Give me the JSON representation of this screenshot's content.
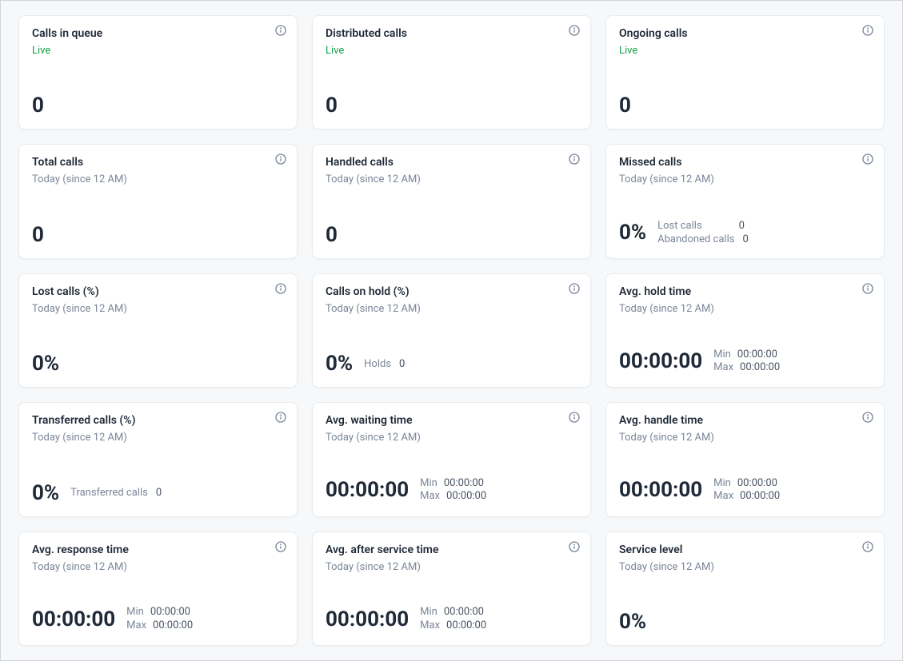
{
  "labels": {
    "live": "Live",
    "today": "Today (since 12 AM)",
    "min": "Min",
    "max": "Max"
  },
  "cards": {
    "calls_in_queue": {
      "title": "Calls in queue",
      "value": "0"
    },
    "distributed_calls": {
      "title": "Distributed calls",
      "value": "0"
    },
    "ongoing_calls": {
      "title": "Ongoing calls",
      "value": "0"
    },
    "total_calls": {
      "title": "Total calls",
      "value": "0"
    },
    "handled_calls": {
      "title": "Handled calls",
      "value": "0"
    },
    "missed_calls": {
      "title": "Missed calls",
      "value": "0%",
      "lost_calls_label": "Lost calls",
      "lost_calls_value": "0",
      "abandoned_label": "Abandoned calls",
      "abandoned_value": "0"
    },
    "lost_calls_pct": {
      "title": "Lost calls (%)",
      "value": "0%"
    },
    "calls_on_hold_pct": {
      "title": "Calls on hold (%)",
      "value": "0%",
      "holds_label": "Holds",
      "holds_value": "0"
    },
    "avg_hold_time": {
      "title": "Avg. hold time",
      "value": "00:00:00",
      "min": "00:00:00",
      "max": "00:00:00"
    },
    "transferred_pct": {
      "title": "Transferred calls (%)",
      "value": "0%",
      "transferred_label": "Transferred calls",
      "transferred_value": "0"
    },
    "avg_waiting_time": {
      "title": "Avg. waiting time",
      "value": "00:00:00",
      "min": "00:00:00",
      "max": "00:00:00"
    },
    "avg_handle_time": {
      "title": "Avg. handle time",
      "value": "00:00:00",
      "min": "00:00:00",
      "max": "00:00:00"
    },
    "avg_response_time": {
      "title": "Avg. response time",
      "value": "00:00:00",
      "min": "00:00:00",
      "max": "00:00:00"
    },
    "avg_after_service": {
      "title": "Avg. after service time",
      "value": "00:00:00",
      "min": "00:00:00",
      "max": "00:00:00"
    },
    "service_level": {
      "title": "Service level",
      "value": "0%"
    }
  }
}
